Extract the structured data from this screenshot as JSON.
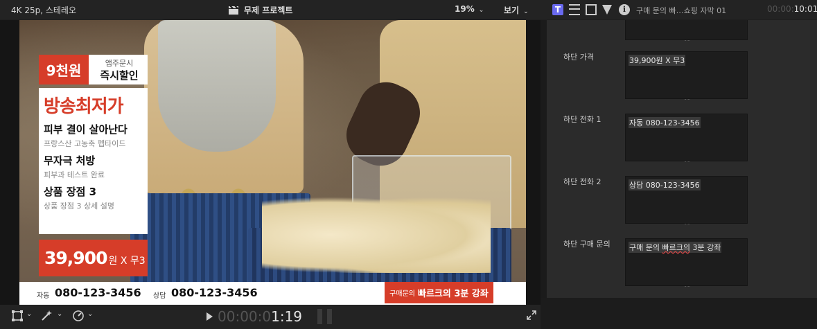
{
  "viewer": {
    "format": "4K 25p, 스테레오",
    "project": "무제 프로젝트",
    "zoom": "19%",
    "view_label": "보기",
    "timecode_dim": "00:00:0",
    "timecode_bright": "1:19"
  },
  "overlay": {
    "tag_price": "9천원",
    "tag_sub1": "앱주문시",
    "tag_sub2": "즉시할인",
    "headline": "방송최저가",
    "feature1_title": "피부 결이 살아난다",
    "feature1_sub": "프랑스산 고농축 펩타이드",
    "feature2_title": "무자극 처방",
    "feature2_sub": "피부과 테스트 완료",
    "feature3_title": "상품 장점 3",
    "feature3_sub": "상품 장점 3 상세 설명",
    "price_num": "39,900",
    "price_unit": "원 X 무3",
    "auto_label": "자동",
    "auto_phone": "080-123-3456",
    "consult_label": "상담",
    "consult_phone": "080-123-3456",
    "order_small": "구매문의",
    "order_big": "빠르크의 3분 강좌"
  },
  "inspector": {
    "title": "구매 문의  빠…쇼핑 자막 01",
    "tc_dim": "00:00:",
    "tc_bright": "10:01",
    "fields": [
      {
        "label": "하단 가격",
        "value": "39,900원 X 무3"
      },
      {
        "label": "하단 전화 1",
        "value": "자동 080-123-3456"
      },
      {
        "label": "하단 전화 2",
        "value": "상담 080-123-3456"
      },
      {
        "label": "하단 구매 문의",
        "value_a": "구매 문의  ",
        "value_b": "빠르크의",
        "value_c": " 3분 강좌"
      }
    ]
  },
  "icons": [
    "clapper-icon",
    "transform-icon",
    "magic-wand-icon",
    "speed-icon",
    "play-icon",
    "expand-icon",
    "text-inspector-icon",
    "lines-icon",
    "film-icon",
    "filter-icon",
    "info-icon"
  ]
}
